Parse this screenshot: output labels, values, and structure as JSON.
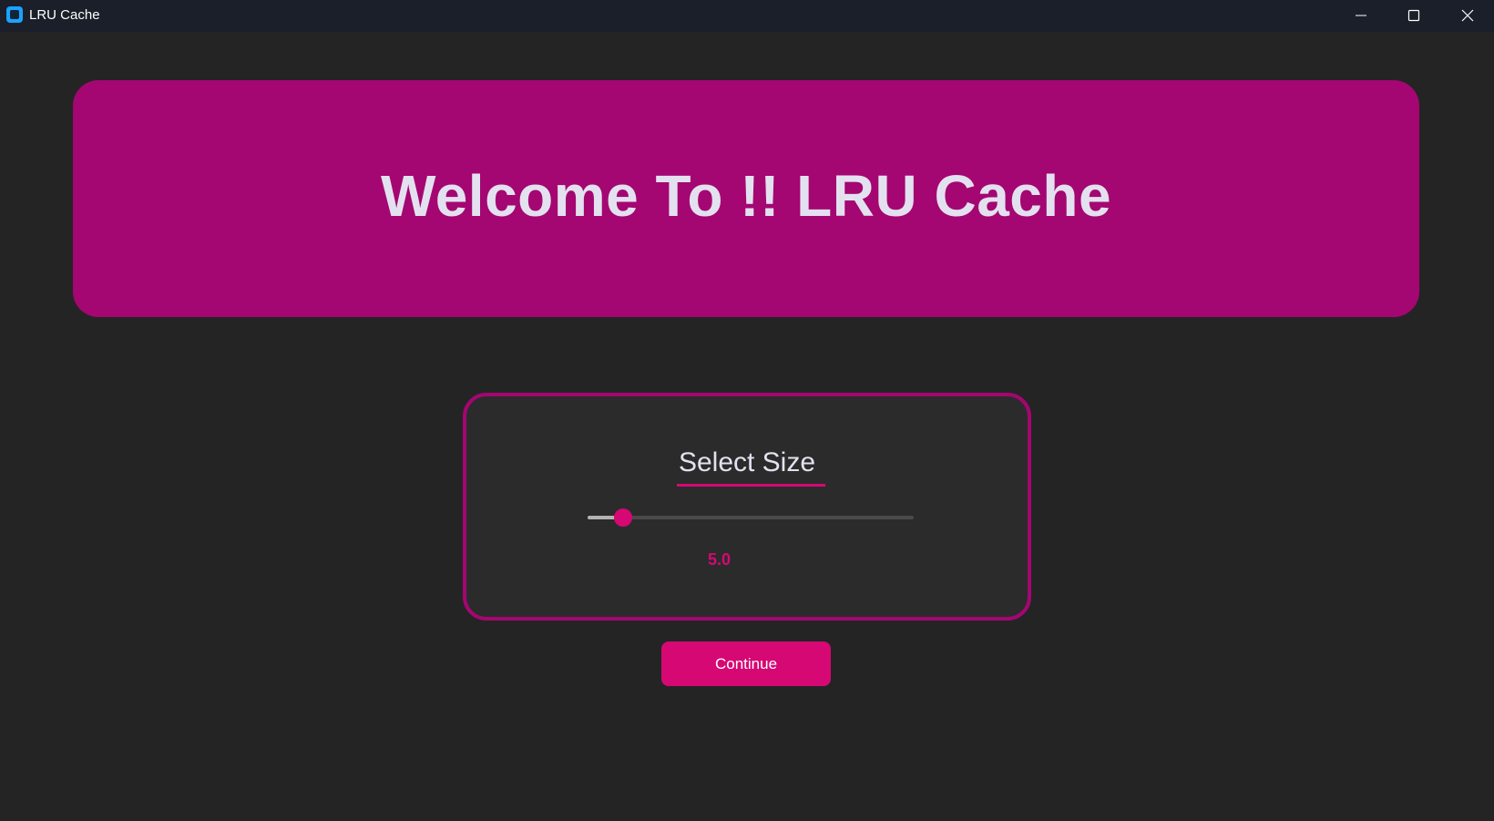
{
  "window": {
    "title": "LRU Cache",
    "controls": [
      "minimize-icon",
      "maximize-icon",
      "close-icon"
    ]
  },
  "banner": {
    "title": "Welcome To !! LRU Cache"
  },
  "size_panel": {
    "heading": "Select Size",
    "slider": {
      "value_label": "5.0",
      "fill_fraction": 0.11
    }
  },
  "actions": {
    "continue_label": "Continue"
  },
  "colors": {
    "background": "#242424",
    "titlebar": "#1b1f2a",
    "banner": "#a40672",
    "accent": "#d60874",
    "text": "#e3e1ef"
  }
}
